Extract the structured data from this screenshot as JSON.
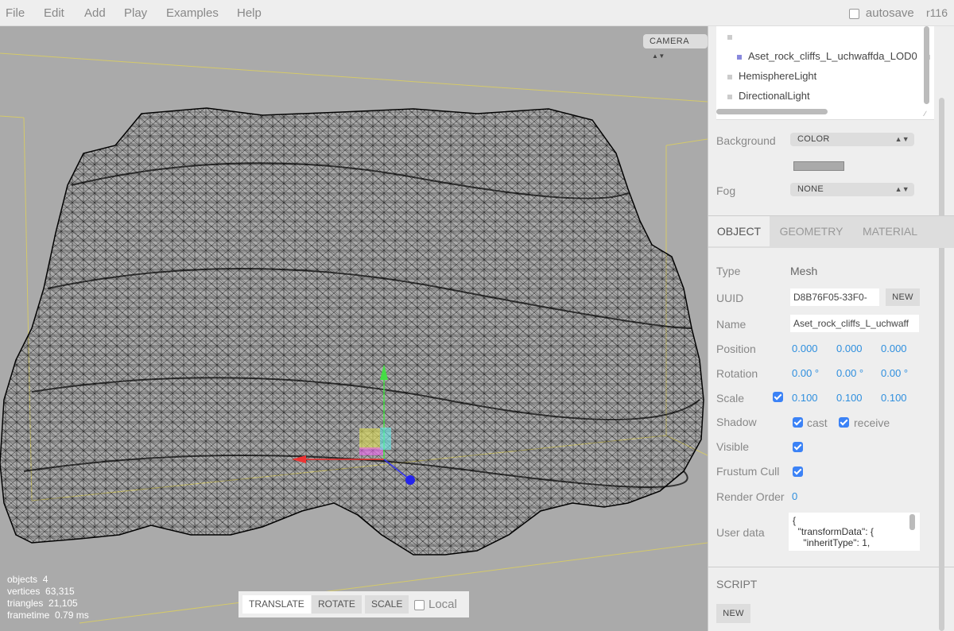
{
  "menubar": {
    "items": [
      "File",
      "Edit",
      "Add",
      "Play",
      "Examples",
      "Help"
    ],
    "autosave_label": "autosave",
    "version": "r116"
  },
  "viewport": {
    "camera_select": "CAMERA",
    "info": {
      "objects_label": "objects",
      "objects_value": "4",
      "vertices_label": "vertices",
      "vertices_value": "63,315",
      "triangles_label": "triangles",
      "triangles_value": "21,105",
      "frametime_label": "frametime",
      "frametime_value": "0.79 ms"
    },
    "toolbar": {
      "translate": "TRANSLATE",
      "rotate": "ROTATE",
      "scale": "SCALE",
      "local": "Local"
    }
  },
  "outliner": {
    "items": [
      "",
      "Aset_rock_cliffs_L_uchwaffda_LOD0",
      "HemisphereLight",
      "DirectionalLight"
    ]
  },
  "scene": {
    "background_label": "Background",
    "background_value": "COLOR",
    "background_color": "#aaaaaa",
    "fog_label": "Fog",
    "fog_value": "NONE"
  },
  "tabs": [
    "OBJECT",
    "GEOMETRY",
    "MATERIAL"
  ],
  "object": {
    "type_label": "Type",
    "type_value": "Mesh",
    "uuid_label": "UUID",
    "uuid_value": "D8B76F05-33F0-",
    "uuid_new": "NEW",
    "name_label": "Name",
    "name_value": "Aset_rock_cliffs_L_uchwaff",
    "position_label": "Position",
    "position": [
      "0.000",
      "0.000",
      "0.000"
    ],
    "rotation_label": "Rotation",
    "rotation": [
      "0.00 °",
      "0.00 °",
      "0.00 °"
    ],
    "scale_label": "Scale",
    "scale": [
      "0.100",
      "0.100",
      "0.100"
    ],
    "shadow_label": "Shadow",
    "cast_label": "cast",
    "receive_label": "receive",
    "visible_label": "Visible",
    "frustum_label": "Frustum Cull",
    "render_order_label": "Render Order",
    "render_order_value": "0",
    "userdata_label": "User data",
    "userdata_lines": [
      "{",
      "  \"transformData\": {",
      "    \"inheritType\": 1,"
    ]
  },
  "script": {
    "title": "SCRIPT",
    "new": "NEW"
  }
}
